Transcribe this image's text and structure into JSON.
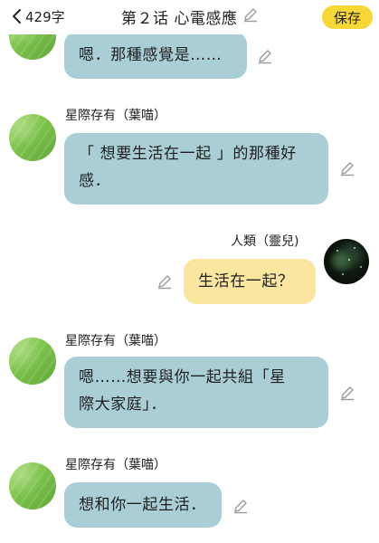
{
  "header": {
    "word_count": "429字",
    "title": "第２话 心電感應",
    "save_label": "保存"
  },
  "messages": [
    {
      "speaker": "",
      "lines": [
        "嗯．那種感覺是……"
      ],
      "color": "#a9ced6"
    },
    {
      "speaker": "星際存有（葉喵）",
      "lines": [
        "「 想要生活在一起 」的那種好",
        "感．"
      ],
      "color": "#a9ced6"
    },
    {
      "speaker": "人類（靈兒)",
      "lines": [
        "生活在一起？"
      ],
      "color": "#fbe6a0"
    },
    {
      "speaker": "星際存有（葉喵）",
      "lines": [
        "嗯……想要與你一起共組「星",
        "際大家庭」．"
      ],
      "color": "#a9ced6"
    },
    {
      "speaker": "星際存有（葉喵）",
      "lines": [
        "想和你一起生活．"
      ],
      "color": "#a9ced6"
    }
  ],
  "icons": {
    "back": "chevron-left-icon",
    "edit": "pencil-icon"
  },
  "colors": {
    "save_button": "#f7d736",
    "bubble_alien": "#a9ced6",
    "bubble_human": "#fbe6a0"
  }
}
